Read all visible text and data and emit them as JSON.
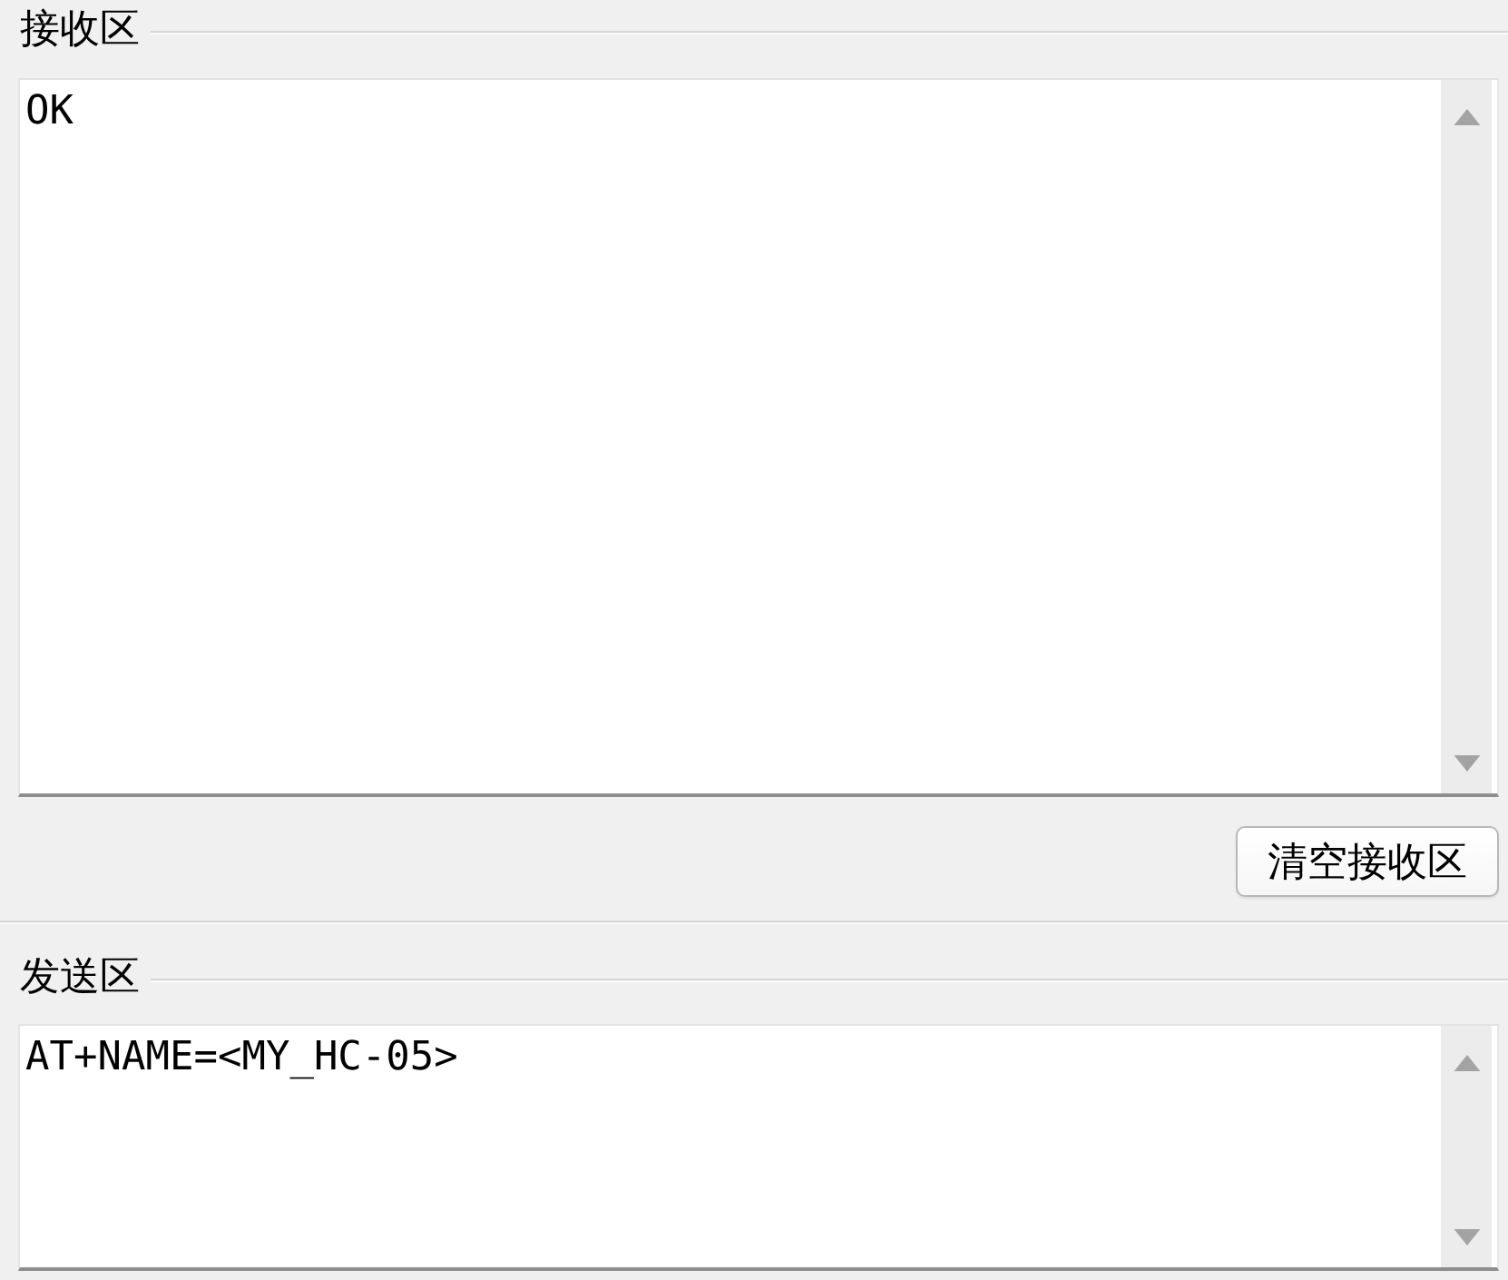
{
  "receive_area": {
    "title": "接收区",
    "text": "OK"
  },
  "clear_button": {
    "label": "清空接收区"
  },
  "send_area": {
    "title": "发送区",
    "text": "AT+NAME=<MY_HC-05>"
  }
}
